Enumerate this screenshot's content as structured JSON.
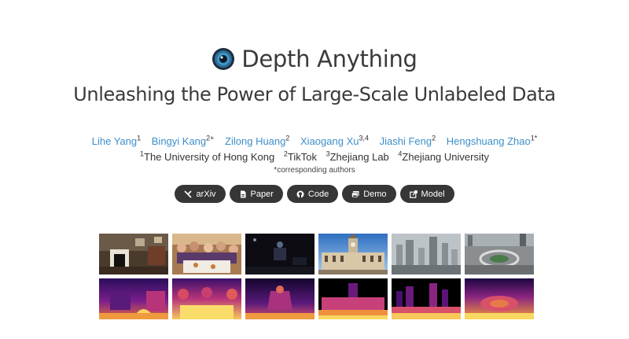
{
  "header": {
    "title": "Depth Anything",
    "subtitle": "Unleashing the Power of Large-Scale Unlabeled Data"
  },
  "authors": [
    {
      "name": "Lihe Yang",
      "sup": "1"
    },
    {
      "name": "Bingyi Kang",
      "sup": "2+"
    },
    {
      "name": "Zilong Huang",
      "sup": "2"
    },
    {
      "name": "Xiaogang Xu",
      "sup": "3,4"
    },
    {
      "name": "Jiashi Feng",
      "sup": "2"
    },
    {
      "name": "Hengshuang Zhao",
      "sup": "1*"
    }
  ],
  "affiliations": [
    {
      "sup": "1",
      "name": "The University of Hong Kong"
    },
    {
      "sup": "2",
      "name": "TikTok"
    },
    {
      "sup": "3",
      "name": "Zhejiang Lab"
    },
    {
      "sup": "4",
      "name": "Zhejiang University"
    }
  ],
  "note": "*corresponding authors",
  "links": [
    {
      "label": "arXiv",
      "icon": "arxiv-icon"
    },
    {
      "label": "Paper",
      "icon": "pdf-icon"
    },
    {
      "label": "Code",
      "icon": "github-icon"
    },
    {
      "label": "Demo",
      "icon": "images-icon"
    },
    {
      "label": "Model",
      "icon": "external-link-icon"
    }
  ],
  "gallery": {
    "scenes": [
      "living-room",
      "dinner-party",
      "dark-room",
      "historic-building",
      "foggy-city",
      "aerial-roundabout"
    ]
  },
  "colors": {
    "link": "#3c8ec9",
    "button": "#363636",
    "text": "#3a3a3a"
  }
}
